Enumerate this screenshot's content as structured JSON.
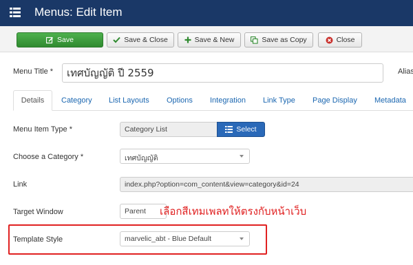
{
  "header": {
    "title": "Menus: Edit Item",
    "icon": "list-icon"
  },
  "toolbar": {
    "save": "Save",
    "save_close": "Save & Close",
    "save_new": "Save & New",
    "save_copy": "Save as Copy",
    "close": "Close"
  },
  "form": {
    "menu_title_label": "Menu Title *",
    "menu_title_value": "เทศบัญญัติ ปี 2559",
    "alias_label": "Alias"
  },
  "tabs": [
    "Details",
    "Category",
    "List Layouts",
    "Options",
    "Integration",
    "Link Type",
    "Page Display",
    "Metadata"
  ],
  "fields": {
    "menu_item_type_label": "Menu Item Type *",
    "menu_item_type_value": "Category List",
    "select_button": "Select",
    "category_label": "Choose a Category *",
    "category_value": "เทศบัญญัติ",
    "link_label": "Link",
    "link_value": "index.php?option=com_content&view=category&id=24",
    "target_label": "Target Window",
    "target_value": "Parent",
    "template_label": "Template Style",
    "template_value": "marvelic_abt - Blue Default"
  },
  "annotation": "เลือกสีเทมเพลทให้ตรงกับหน้าเว็บ",
  "colors": {
    "header_bg": "#1a3867",
    "save_green": "#3a9c3a",
    "select_blue": "#2a69b8",
    "annotation_red": "#e02020",
    "link_blue": "#1a66b0"
  }
}
